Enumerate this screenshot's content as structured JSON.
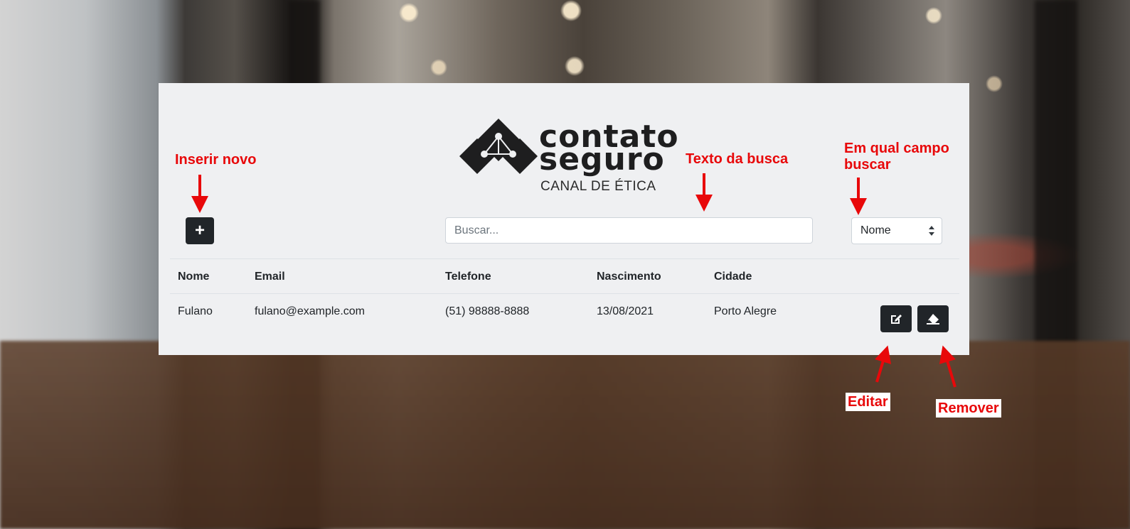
{
  "brand": {
    "logo_line1": "contato",
    "logo_line2": "seguro",
    "tagline": "CANAL DE ÉTICA"
  },
  "toolbar": {
    "add_icon": "plus-icon",
    "add_label": "+",
    "search_placeholder": "Buscar...",
    "search_value": "",
    "field_selected": "Nome"
  },
  "table": {
    "headers": [
      "Nome",
      "Email",
      "Telefone",
      "Nascimento",
      "Cidade"
    ],
    "rows": [
      {
        "nome": "Fulano",
        "email": "fulano@example.com",
        "telefone": "(51) 98888-8888",
        "nascimento": "13/08/2021",
        "cidade": "Porto Alegre",
        "edit_icon": "edit-icon",
        "remove_icon": "eraser-icon"
      }
    ]
  },
  "annotations": {
    "insert_new": "Inserir novo",
    "search_text": "Texto da busca",
    "search_field_line1": "Em qual campo",
    "search_field_line2": "buscar",
    "edit": "Editar",
    "remove": "Remover"
  },
  "colors": {
    "panel_bg": "#eff0f2",
    "button_dark": "#212529",
    "annotation_red": "#e8080a"
  }
}
